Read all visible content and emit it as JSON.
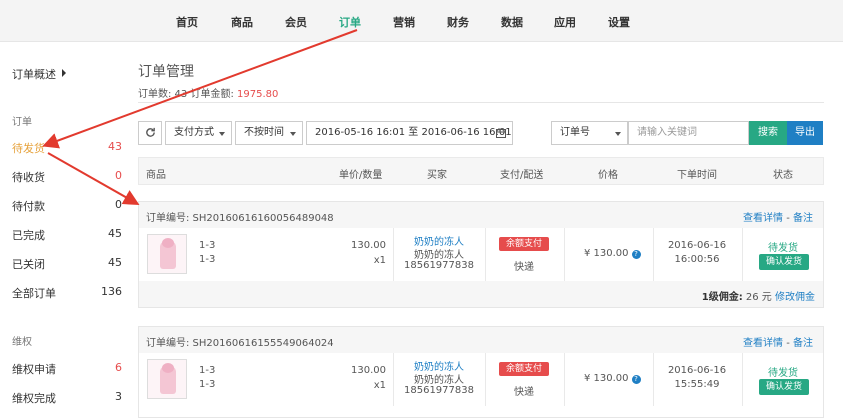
{
  "topnav": {
    "items": [
      "首页",
      "商品",
      "会员",
      "订单",
      "营销",
      "财务",
      "数据",
      "应用",
      "设置"
    ],
    "active_index": 3,
    "accent_color": "#27a884"
  },
  "sidebar": {
    "overview_label": "订单概述",
    "group_order": "订单",
    "order_rows": [
      {
        "label": "待发货",
        "count": "43"
      },
      {
        "label": "待收货",
        "count": "0"
      },
      {
        "label": "待付款",
        "count": "0"
      },
      {
        "label": "已完成",
        "count": "45"
      },
      {
        "label": "已关闭",
        "count": "45"
      },
      {
        "label": "全部订单",
        "count": "136"
      }
    ],
    "group_rights": "维权",
    "rights_rows": [
      {
        "label": "维权申请",
        "count": "6"
      },
      {
        "label": "维权完成",
        "count": "3"
      }
    ]
  },
  "main": {
    "title": "订单管理",
    "summary_prefix": "订单数: 43 订单金额: ",
    "summary_amount": "1975.80",
    "toolbar": {
      "refresh_icon": "refresh-icon",
      "pay_method": "支付方式",
      "time_filter": "不按时间",
      "date_range": "2016-05-16 16:01 至 2016-06-16 16:01",
      "calendar_icon": "calendar-icon",
      "field_select": "订单号",
      "keyword_placeholder": "请输入关键词",
      "search_label": "搜索",
      "export_label": "导出"
    },
    "table_headers": [
      "商品",
      "单价/数量",
      "买家",
      "支付/配送",
      "价格",
      "下单时间",
      "状态"
    ],
    "orders": [
      {
        "order_no": "订单编号: SH20160616160056489048",
        "view_detail": "查看详情",
        "separator": "-",
        "remark": "备注",
        "spec1": "1-3",
        "spec2": "1-3",
        "unit_price": "130.00",
        "quantity": "x1",
        "buyer_name": "奶奶的冻人",
        "buyer_nick": "奶奶的冻人",
        "buyer_phone": "18561977838",
        "pay_label": "余额支付",
        "delivery": "快递",
        "amount": "¥ 130.00",
        "order_date": "2016-06-16",
        "order_time": "16:00:56",
        "status": "待发货",
        "confirm_label": "确认发货",
        "commission_label": "1级佣金:",
        "commission_value": "26 元",
        "modify_commission": "修改佣金"
      },
      {
        "order_no": "订单编号: SH20160616155549064024",
        "view_detail": "查看详情",
        "separator": "-",
        "remark": "备注",
        "spec1": "1-3",
        "spec2": "1-3",
        "unit_price": "130.00",
        "quantity": "x1",
        "buyer_name": "奶奶的冻人",
        "buyer_nick": "奶奶的冻人",
        "buyer_phone": "18561977838",
        "pay_label": "余额支付",
        "delivery": "快递",
        "amount": "¥ 130.00",
        "order_date": "2016-06-16",
        "order_time": "15:55:49",
        "status": "待发货",
        "confirm_label": "确认发货"
      }
    ]
  },
  "colors": {
    "accent": "#27a884",
    "primary": "#1f7fc4",
    "warning": "#e6a23c",
    "danger": "#e64c4c",
    "annotation_arrow": "#e23a2e"
  }
}
